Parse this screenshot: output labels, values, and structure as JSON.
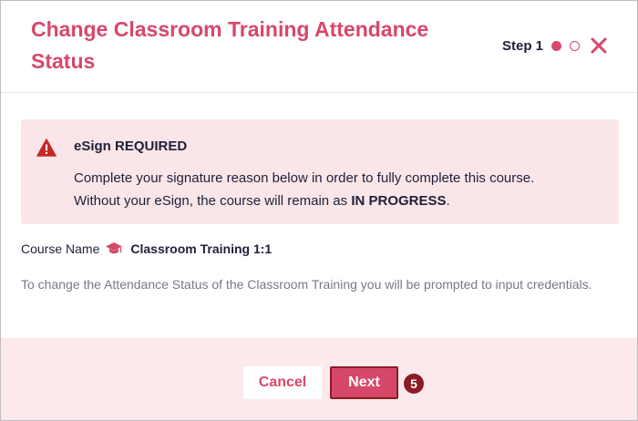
{
  "modal": {
    "title": "Change Classroom Training Attendance Status",
    "step_label": "Step 1",
    "steps": [
      "current",
      "pending"
    ],
    "close_icon": "close-icon"
  },
  "alert": {
    "icon": "warning-icon",
    "title": "eSign REQUIRED",
    "text_line1": "Complete your signature reason below in order to fully complete this course.",
    "text_line2_prefix": "Without your eSign, the course will remain as ",
    "text_line2_status": "IN PROGRESS",
    "text_line2_suffix": "."
  },
  "course": {
    "label": "Course Name",
    "icon": "graduation-cap-icon",
    "name": "Classroom Training 1:1"
  },
  "info_text": "To change the Attendance Status of the Classroom Training you will be prompted to input credentials.",
  "footer": {
    "cancel_label": "Cancel",
    "next_label": "Next",
    "callout_number": "5"
  },
  "colors": {
    "accent": "#d6486a",
    "alert_bg": "#fae6e8",
    "footer_bg": "#fbe9ec",
    "callout": "#8b1c24",
    "text": "#1f1f3a"
  }
}
